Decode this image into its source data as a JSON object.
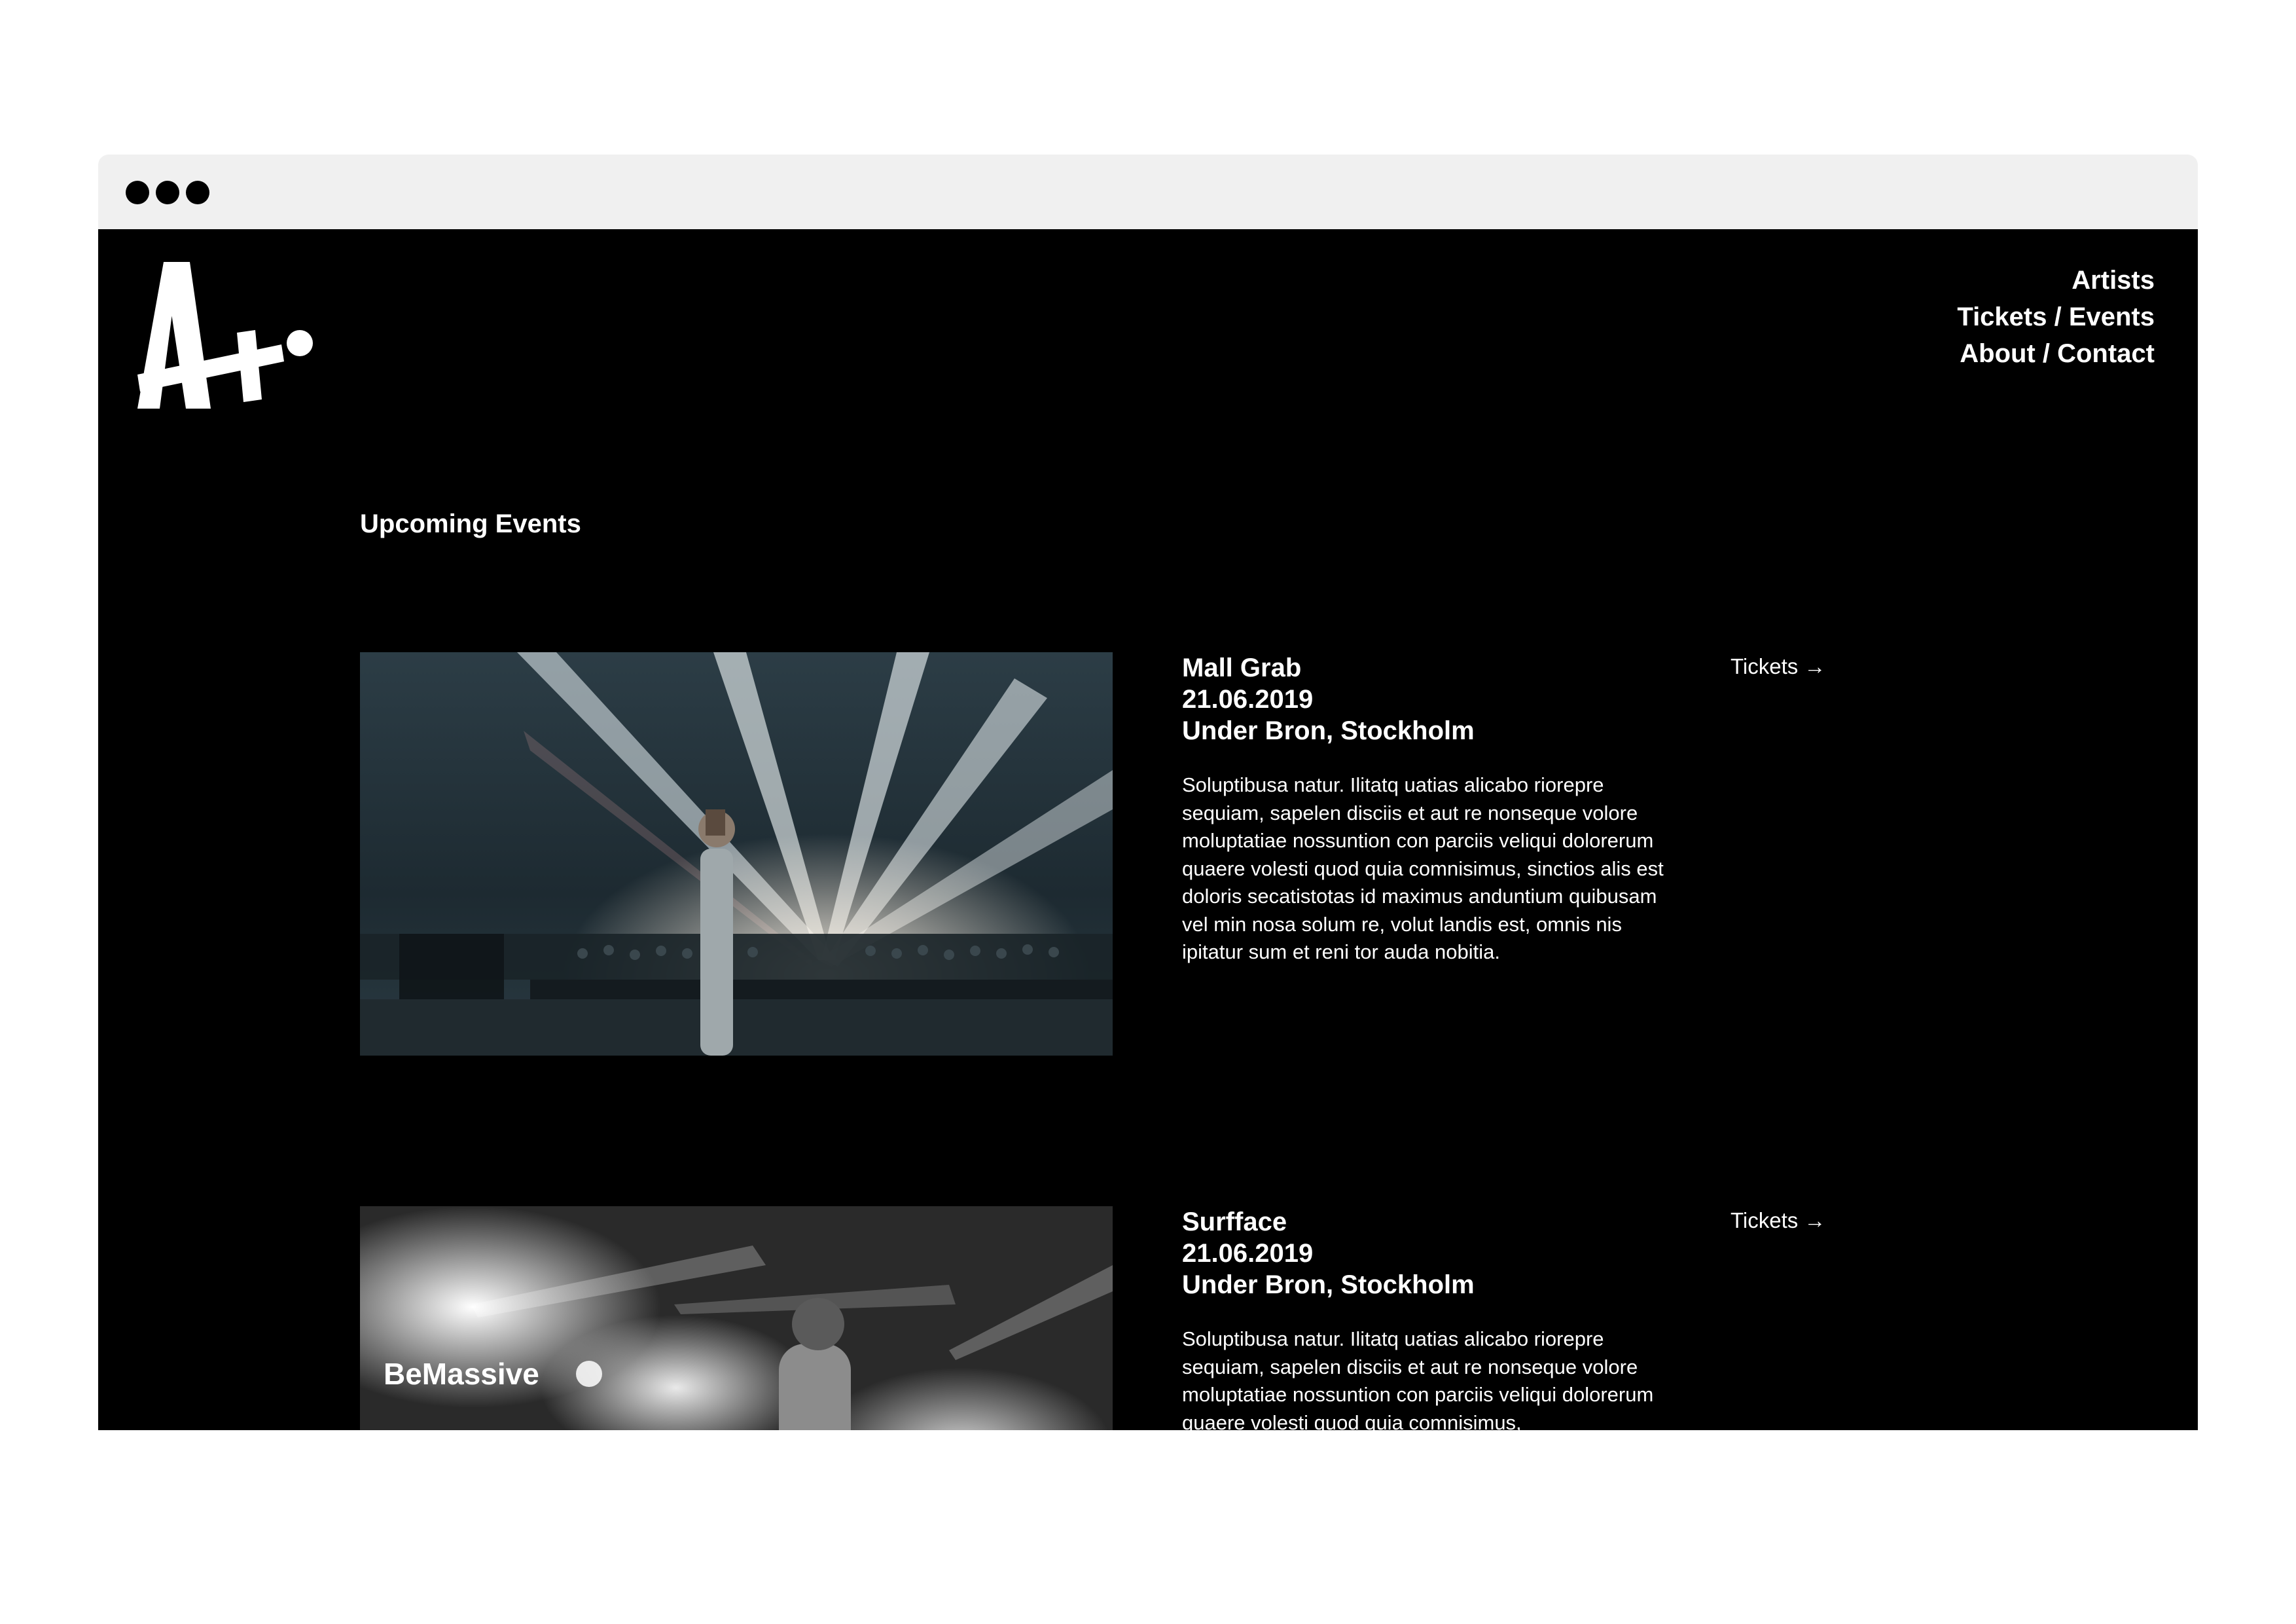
{
  "nav": {
    "items": [
      {
        "label": "Artists"
      },
      {
        "label": "Tickets / Events"
      },
      {
        "label": "About / Contact"
      }
    ]
  },
  "main": {
    "title": "Upcoming Events",
    "events": [
      {
        "artist": "Mall Grab",
        "date": "21.06.2019",
        "venue": "Under Bron, Stockholm",
        "description": "Soluptibusa natur. Ilitatq uatias alicabo riorepre sequiam, sapelen disciis et aut re nonseque volore moluptatiae nossuntion con parciis veliqui dolorerum quaere volesti quod quia comnisimus, sinctios alis est doloris secatistotas id maximus anduntium quibusam vel min nosa solum re, volut landis est, omnis nis ipitatur sum et reni tor auda nobitia.",
        "tickets_label": "Tickets →"
      },
      {
        "artist": "Surfface",
        "date": "21.06.2019",
        "venue": "Under Bron, Stockholm",
        "description": "Soluptibusa natur. Ilitatq uatias alicabo riorepre sequiam, sapelen disciis et aut re nonseque volore moluptatiae nossuntion con parciis veliqui dolorerum quaere volesti quod quia comnisimus,",
        "tickets_label": "Tickets →",
        "image_logo_text": "BeMassive"
      }
    ]
  },
  "colors": {
    "background": "#000000",
    "text": "#ffffff",
    "titlebar": "#f0f0f0",
    "photo1_tint": "#2a3b44"
  }
}
